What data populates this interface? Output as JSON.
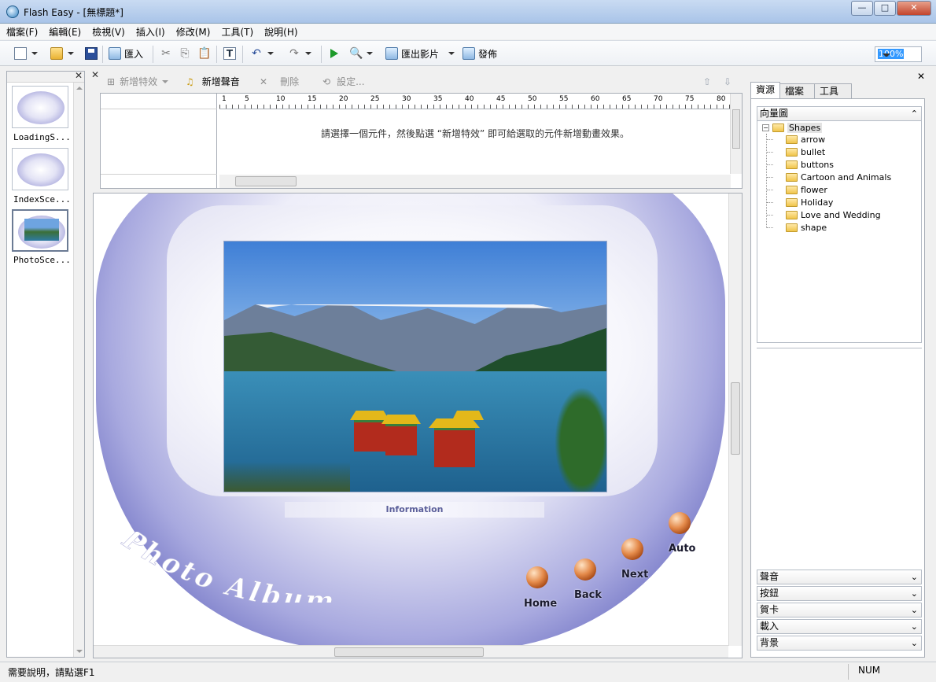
{
  "window": {
    "title": "Flash Easy - [無標題*]",
    "min": "—",
    "max": "□",
    "close": "✕"
  },
  "menu": [
    "檔案(F)",
    "編輯(E)",
    "檢視(V)",
    "插入(I)",
    "修改(M)",
    "工具(T)",
    "說明(H)"
  ],
  "toolbar": {
    "import_label": "匯入",
    "export_label": "匯出影片",
    "publish_label": "發佈",
    "zoom": "100%"
  },
  "scenes": [
    {
      "label": "LoadingS..."
    },
    {
      "label": "IndexSce..."
    },
    {
      "label": "PhotoSce..."
    }
  ],
  "effects": {
    "add_effect": "新增特效",
    "add_sound": "新增聲音",
    "delete": "刪除",
    "settings": "設定..."
  },
  "timeline": {
    "ruler": [
      "1",
      "5",
      "10",
      "15",
      "20",
      "25",
      "30",
      "35",
      "40",
      "45",
      "50",
      "55",
      "60",
      "65",
      "70",
      "75",
      "80"
    ],
    "hint": "請選擇一個元件，然後點選 “新增特效” 即可給選取的元件新增動畫效果。"
  },
  "stage": {
    "info": "Information",
    "album_title": "Photo Album",
    "buttons": {
      "home": "Home",
      "back": "Back",
      "next": "Next",
      "auto": "Auto"
    }
  },
  "resources": {
    "tabs": [
      "資源",
      "檔案",
      "工具"
    ],
    "section": "向量圖",
    "root": "Shapes",
    "folders": [
      "arrow",
      "bullet",
      "buttons",
      "Cartoon and Animals",
      "flower",
      "Holiday",
      "Love and Wedding",
      "shape"
    ],
    "collapsed_sections": [
      "聲音",
      "按鈕",
      "賀卡",
      "載入",
      "背景"
    ]
  },
  "status": {
    "help": "需要說明，請點選F1",
    "num": "NUM"
  }
}
